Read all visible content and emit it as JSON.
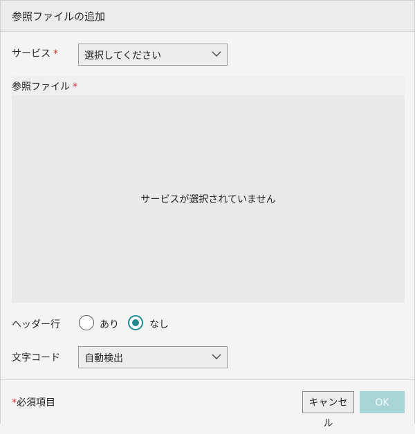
{
  "dialog": {
    "title": "参照ファイルの追加"
  },
  "service": {
    "label": "サービス",
    "required_mark": "*",
    "select_value": "選択してください",
    "icon": "chevron-down-icon"
  },
  "reference_file": {
    "label": "参照ファイル",
    "required_mark": "*",
    "empty_message": "サービスが選択されていません"
  },
  "header_row": {
    "label": "ヘッダー行",
    "options": [
      {
        "label": "あり",
        "checked": false
      },
      {
        "label": "なし",
        "checked": true
      }
    ]
  },
  "encoding": {
    "label": "文字コード",
    "select_value": "自動検出",
    "icon": "chevron-down-icon"
  },
  "footer": {
    "required_mark": "*",
    "required_note": "必須項目",
    "cancel_label": "キャンセル",
    "ok_label": "OK"
  },
  "colors": {
    "accent": "#1e8a90",
    "ok_disabled": "#a9d4d6",
    "required": "#c0392b"
  }
}
